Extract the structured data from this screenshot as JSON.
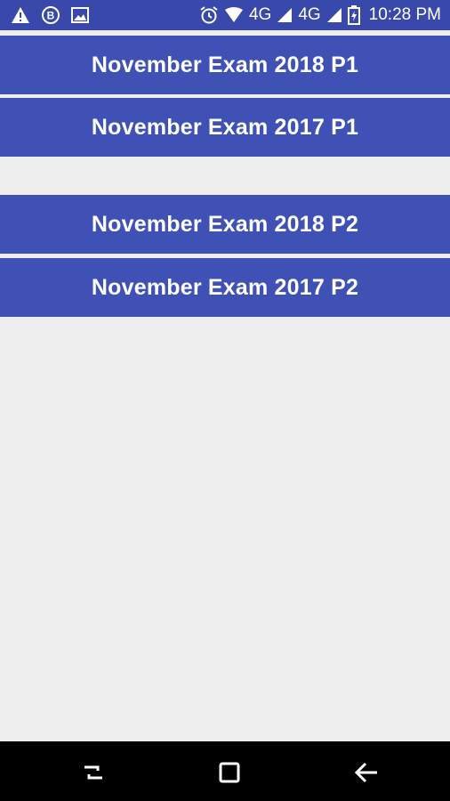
{
  "status_bar": {
    "network_1": "4G",
    "network_2": "4G",
    "time": "10:28 PM",
    "icons": [
      "warning-icon",
      "b-badge-icon",
      "image-icon",
      "alarm-icon",
      "wifi-icon",
      "signal-icon",
      "signal-icon",
      "battery-icon"
    ]
  },
  "exams": [
    {
      "label": "November Exam 2018 P1"
    },
    {
      "label": "November Exam 2017 P1"
    },
    {
      "label": "November Exam 2018 P2"
    },
    {
      "label": "November Exam 2017 P2"
    }
  ],
  "nav_bar": {
    "icons": [
      "recents-icon",
      "home-icon",
      "back-icon"
    ]
  },
  "colors": {
    "button_bg": "#3f51b5",
    "status_bar_bg": "#3949ab",
    "page_bg": "#eeeeee",
    "nav_bg": "#000000"
  }
}
